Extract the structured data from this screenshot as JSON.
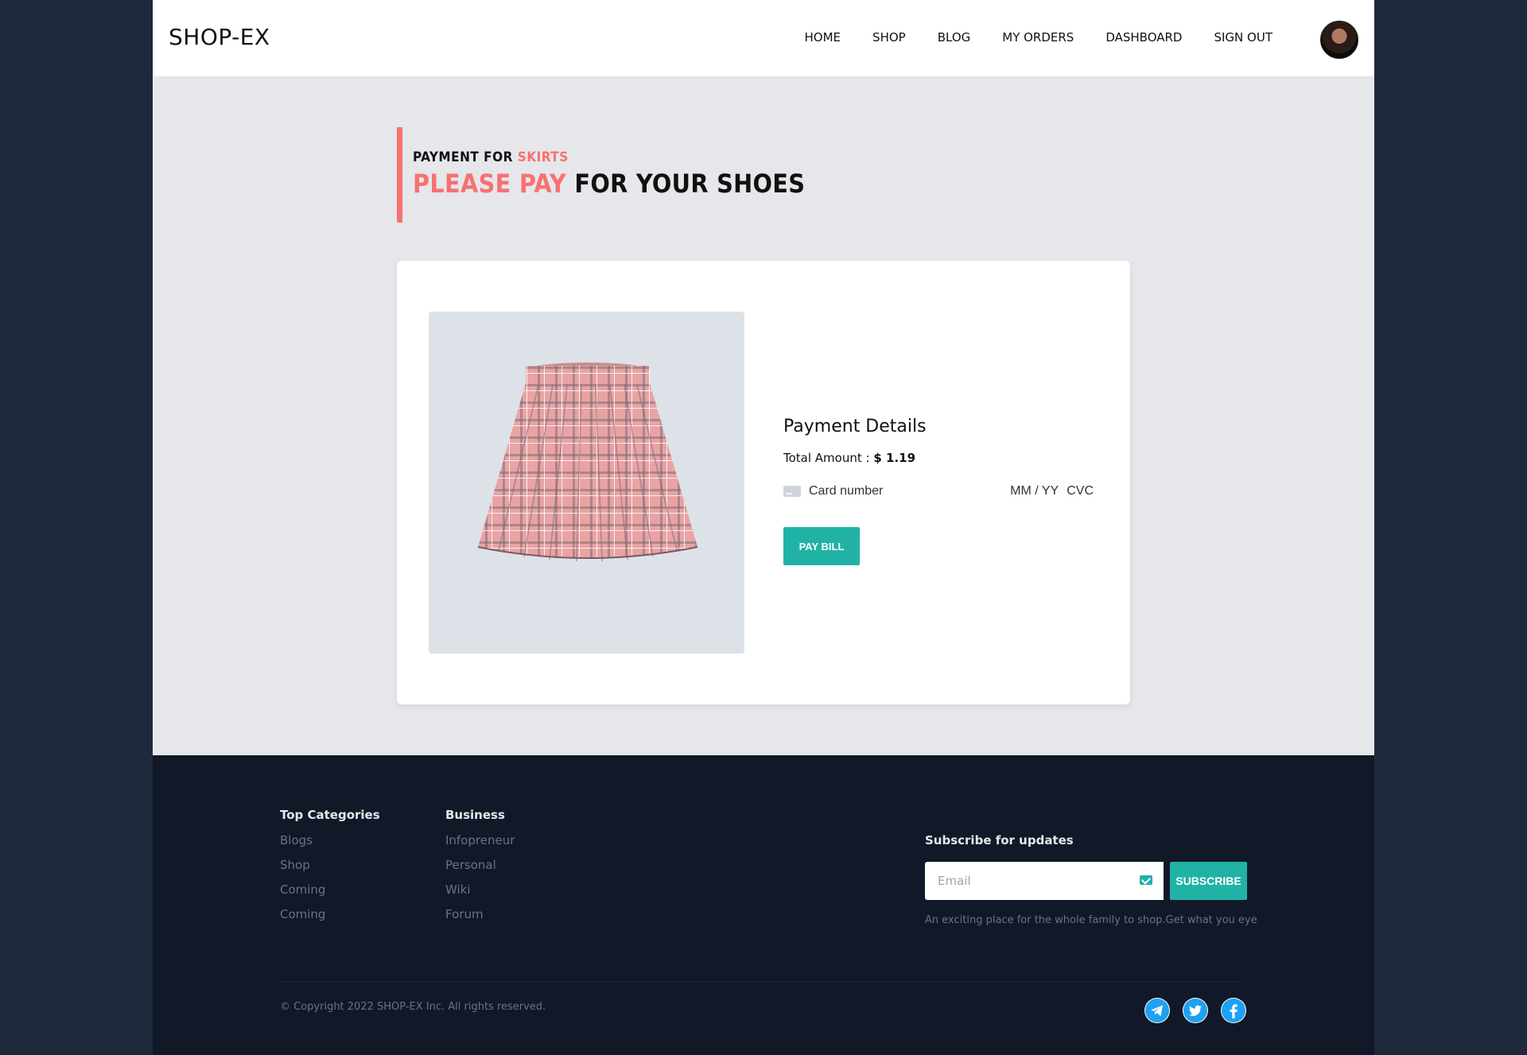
{
  "header": {
    "logo": "SHOP-EX",
    "nav": [
      "HOME",
      "SHOP",
      "BLOG",
      "MY ORDERS",
      "DASHBOARD",
      "SIGN OUT"
    ]
  },
  "heading": {
    "sub_prefix": "PAYMENT FOR ",
    "sub_accent": "SKIRTS",
    "main_accent": "PLEASE PAY",
    "main_rest": " FOR YOUR SHOES"
  },
  "payment": {
    "title": "Payment Details",
    "total_label": "Total Amount : ",
    "total_value": "$ 1.19",
    "card_placeholder": "Card number",
    "expiry_placeholder": "MM / YY",
    "cvc_placeholder": "CVC",
    "pay_button": "PAY BILL"
  },
  "footer": {
    "col1": {
      "title": "Top Categories",
      "links": [
        "Blogs",
        "Shop",
        "Coming",
        "Coming"
      ]
    },
    "col2": {
      "title": "Business",
      "links": [
        "Infopreneur",
        "Personal",
        "Wiki",
        "Forum"
      ]
    },
    "subscribe_title": "Subscribe for updates",
    "email_placeholder": "Email",
    "subscribe_button": "SUBSCRIBE",
    "subscribe_note": "An exciting place for the whole family to shop.Get what you eye",
    "copyright": "© Copyright 2022 SHOP-EX Inc. All rights reserved.",
    "social_icons": [
      "telegram-icon",
      "twitter-icon",
      "facebook-icon"
    ]
  },
  "colors": {
    "accent": "#f87171",
    "teal": "#20b2a5",
    "footer_bg": "#111827",
    "page_bg": "#e5e7eb"
  }
}
